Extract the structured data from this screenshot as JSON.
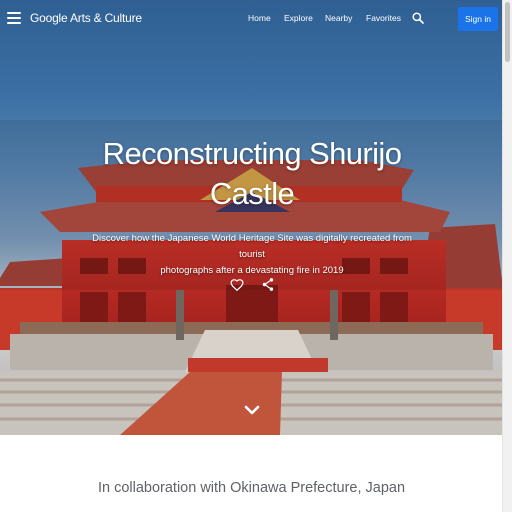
{
  "header": {
    "menu_icon": "hamburger-menu-icon",
    "brand": "Google Arts & Culture",
    "nav": [
      "Home",
      "Explore",
      "Nearby",
      "Favorites"
    ],
    "search_icon": "search-icon",
    "signin_label": "Sign in",
    "signin_color": "#1a73e8"
  },
  "hero": {
    "title_line1": "Reconstructing Shurijo",
    "title_line2": "Castle",
    "subtitle_line1": "Discover how the Japanese World Heritage Site was digitally recreated from tourist",
    "subtitle_line2": "photographs after a devastating fire in 2019",
    "favorite_icon": "heart-icon",
    "share_icon": "share-icon",
    "scroll_icon": "chevron-down-icon"
  },
  "collaboration": {
    "text": "In collaboration with Okinawa Prefecture, Japan"
  }
}
